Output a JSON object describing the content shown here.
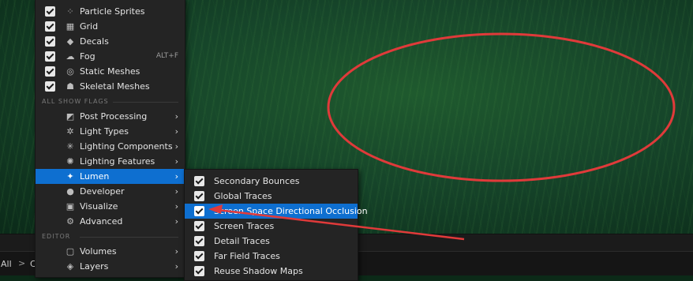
{
  "show_flags_menu": {
    "top_items": [
      {
        "label": "Particle Sprites",
        "checked": true,
        "icon": "sparkles-icon"
      },
      {
        "label": "Grid",
        "checked": true,
        "icon": "grid-icon"
      },
      {
        "label": "Decals",
        "checked": true,
        "icon": "decal-icon"
      },
      {
        "label": "Fog",
        "checked": true,
        "icon": "fog-icon",
        "shortcut": "ALT+F"
      },
      {
        "label": "Static Meshes",
        "checked": true,
        "icon": "static-mesh-icon"
      },
      {
        "label": "Skeletal Meshes",
        "checked": true,
        "icon": "skeletal-mesh-icon"
      }
    ],
    "all_show_flags_header": "ALL SHOW FLAGS",
    "flag_groups": [
      {
        "label": "Post Processing",
        "icon": "post-processing-icon"
      },
      {
        "label": "Light Types",
        "icon": "light-types-icon"
      },
      {
        "label": "Lighting Components",
        "icon": "lighting-components-icon"
      },
      {
        "label": "Lighting Features",
        "icon": "lighting-features-icon"
      },
      {
        "label": "Lumen",
        "icon": "lumen-icon",
        "selected": true
      },
      {
        "label": "Developer",
        "icon": "developer-icon"
      },
      {
        "label": "Visualize",
        "icon": "visualize-icon"
      },
      {
        "label": "Advanced",
        "icon": "advanced-icon"
      }
    ],
    "editor_header": "EDITOR",
    "editor_items": [
      {
        "label": "Volumes",
        "icon": "volumes-icon"
      },
      {
        "label": "Layers",
        "icon": "layers-icon"
      }
    ]
  },
  "lumen_submenu": {
    "items": [
      {
        "label": "Secondary Bounces",
        "checked": true
      },
      {
        "label": "Global Traces",
        "checked": true
      },
      {
        "label": "Screen Space Directional Occlusion",
        "checked": true,
        "selected": true
      },
      {
        "label": "Screen Traces",
        "checked": true
      },
      {
        "label": "Detail Traces",
        "checked": true
      },
      {
        "label": "Far Field Traces",
        "checked": true
      },
      {
        "label": "Reuse Shadow Maps",
        "checked": true
      }
    ]
  },
  "content_browser": {
    "all_label": "All",
    "separator": ">",
    "truncated": "C"
  },
  "arrow_glyph": "›",
  "colors": {
    "selection": "#0e6fd0",
    "annotation": "#e03a3a",
    "menu_bg": "#242424"
  }
}
